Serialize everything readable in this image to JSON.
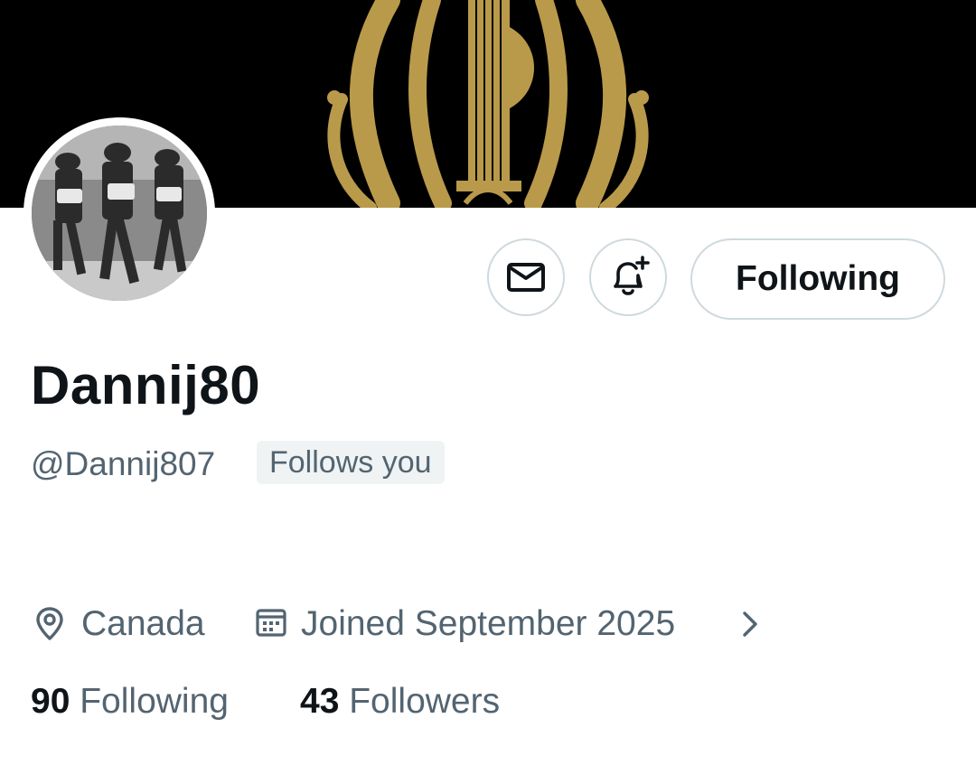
{
  "profile": {
    "display_name": "Dannij80",
    "handle": "@Dannij807",
    "follows_you_badge": "Follows you",
    "location": "Canada",
    "joined": "Joined September 2025"
  },
  "actions": {
    "message_icon": "envelope-icon",
    "notify_icon": "bell-plus-icon",
    "following_label": "Following"
  },
  "stats": {
    "following_count": "90",
    "following_label": "Following",
    "followers_count": "43",
    "followers_label": "Followers"
  },
  "colors": {
    "banner_bg": "#000000",
    "emblem_gold": "#b89a4a",
    "text_primary": "#0f1419",
    "text_secondary": "#536471",
    "border": "#cfd9de",
    "badge_bg": "#eff3f4"
  },
  "icons": [
    "location-pin-icon",
    "calendar-icon",
    "chevron-right-icon"
  ]
}
